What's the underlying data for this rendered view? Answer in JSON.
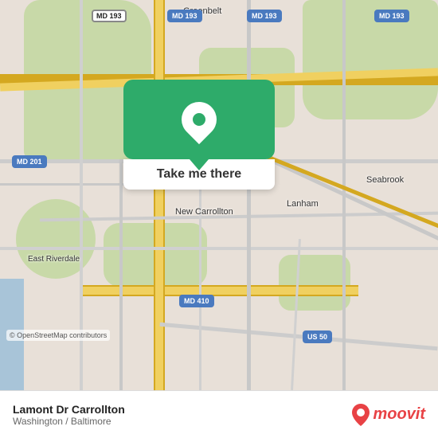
{
  "map": {
    "osm_credit": "© OpenStreetMap contributors"
  },
  "card": {
    "button_label": "Take me there"
  },
  "route_badges": {
    "md193_labels": [
      "MD 193",
      "MD 193",
      "MD 193",
      "MD 193"
    ],
    "md201_label": "MD 201",
    "md410_label": "MD 410",
    "us50_label": "US 50"
  },
  "places": {
    "greenbelt": "Greenbelt",
    "new_carrollton": "New Carrollton",
    "lanham": "Lanham",
    "seabrook": "Seabrook",
    "east_riverdale": "East Riverdale"
  },
  "bottom_bar": {
    "title": "Lamont Dr Carrollton",
    "subtitle": "Washington / Baltimore",
    "logo_text": "moovit"
  }
}
